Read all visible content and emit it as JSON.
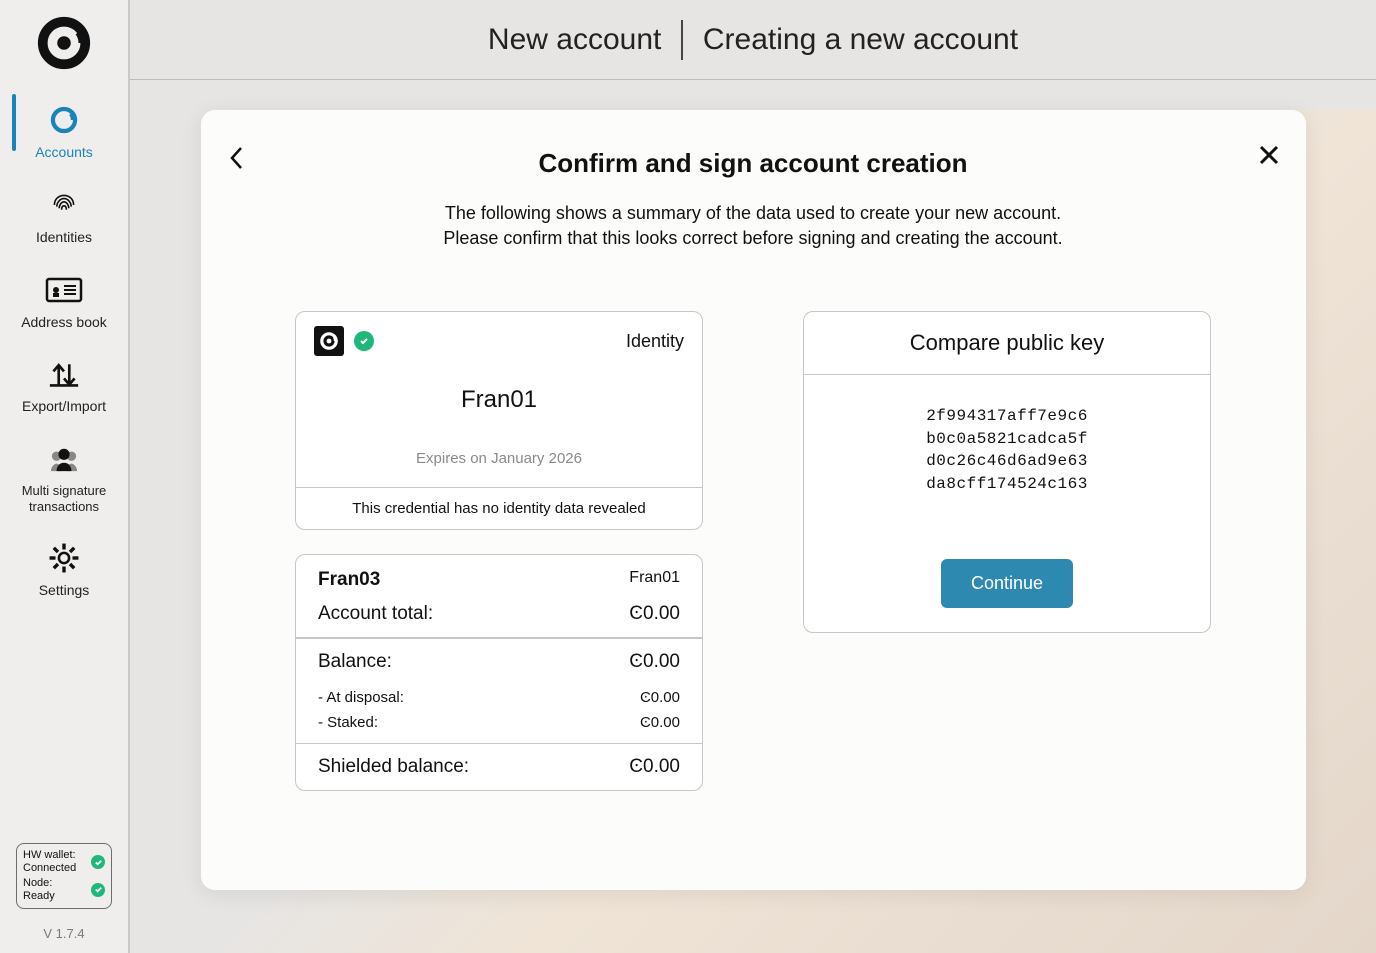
{
  "sidebar": {
    "items": [
      {
        "label": "Accounts"
      },
      {
        "label": "Identities"
      },
      {
        "label": "Address book"
      },
      {
        "label": "Export/Import"
      },
      {
        "label": "Multi signature\ntransactions"
      },
      {
        "label": "Settings"
      }
    ],
    "status": {
      "hw_label": "HW wallet:",
      "hw_value": "Connected",
      "node_label": "Node:",
      "node_value": "Ready"
    },
    "version": "V 1.7.4"
  },
  "topbar": {
    "left": "New account",
    "right": "Creating a new account"
  },
  "modal": {
    "title": "Confirm and sign account creation",
    "desc1": "The following shows a summary of the data used to create your new account.",
    "desc2": "Please confirm that this looks correct before signing and creating the account."
  },
  "identity": {
    "label": "Identity",
    "name": "Fran01",
    "expires": "Expires on January 2026",
    "footer": "This credential has no identity data revealed"
  },
  "account": {
    "name": "Fran03",
    "identity_ref": "Fran01",
    "total_label": "Account total:",
    "total_value": "Ͼ0.00",
    "balance_label": "Balance:",
    "balance_value": "Ͼ0.00",
    "disposal_label": "- At disposal:",
    "disposal_value": "Ͼ0.00",
    "staked_label": "- Staked:",
    "staked_value": "Ͼ0.00",
    "shielded_label": "Shielded balance:",
    "shielded_value": "Ͼ0.00"
  },
  "pubkey": {
    "title": "Compare public key",
    "line1": "2f994317aff7e9c6",
    "line2": "b0c0a5821cadca5f",
    "line3": "d0c26c46d6ad9e63",
    "line4": "da8cff174524c163",
    "continue": "Continue"
  }
}
